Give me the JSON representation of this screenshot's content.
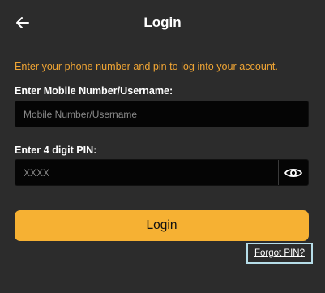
{
  "header": {
    "title": "Login",
    "back_icon": "arrow-left-icon"
  },
  "intro_text": "Enter your phone number and pin to log into your account.",
  "username": {
    "label": "Enter Mobile Number/Username:",
    "placeholder": "Mobile Number/Username",
    "value": ""
  },
  "pin": {
    "label": "Enter 4 digit PIN:",
    "placeholder": "XXXX",
    "value": "",
    "toggle_icon": "eye-icon"
  },
  "login_button_label": "Login",
  "forgot_pin_label": "Forgot PIN?",
  "colors": {
    "background": "#2c2c2c",
    "accent": "#f6b133",
    "intro_text": "#f0a534",
    "field_background": "#050505",
    "focus_outline": "#b6dde8"
  }
}
